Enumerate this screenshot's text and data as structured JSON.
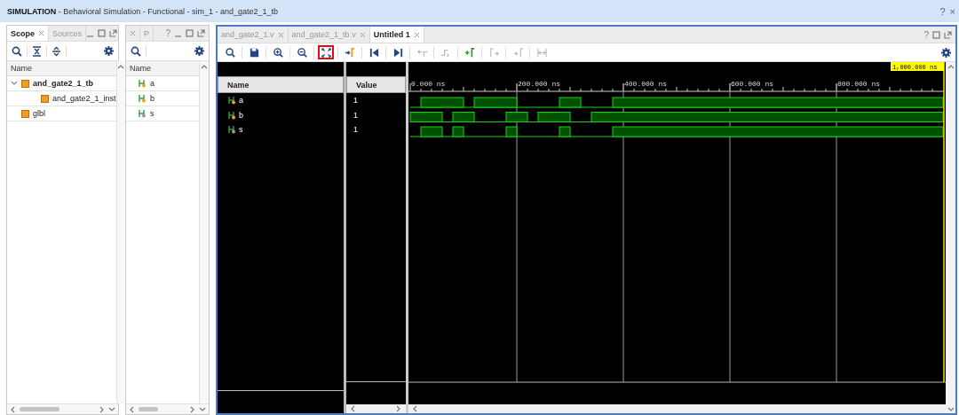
{
  "title_bar": {
    "title": "**SIMULATION** - Behavioral Simulation - Functional - sim_1 - and_gate2_1_tb",
    "help": "?",
    "close": "×"
  },
  "scope_panel": {
    "tabs": [
      {
        "label": "Scope",
        "selected": true
      },
      {
        "label": "Sources",
        "selected": false
      }
    ],
    "column": "Name",
    "tree": [
      {
        "name": "and_gate2_1_tb",
        "expanded": true,
        "children": [
          {
            "name": "and_gate2_1_inst"
          }
        ]
      },
      {
        "name": "glbl"
      }
    ]
  },
  "objects_panel": {
    "tabs": [
      {
        "label": "P",
        "selected": false
      }
    ],
    "help": "?",
    "column": "Name",
    "objects": [
      {
        "name": "a",
        "kind": "input"
      },
      {
        "name": "b",
        "kind": "input"
      },
      {
        "name": "s",
        "kind": "output"
      }
    ]
  },
  "wave_window": {
    "tabs": [
      {
        "label": "and_gate2_1.v",
        "selected": false
      },
      {
        "label": "and_gate2_1_tb.v",
        "selected": false
      },
      {
        "label": "Untitled 1",
        "selected": true
      }
    ],
    "help": "?",
    "toolbar": [
      {
        "kind": "search",
        "disabled": false,
        "highlighted": false
      },
      {
        "kind": "save",
        "disabled": false,
        "highlighted": false
      },
      {
        "kind": "zoom-in",
        "disabled": false,
        "highlighted": false
      },
      {
        "kind": "zoom-out",
        "disabled": false,
        "highlighted": false
      },
      {
        "kind": "zoom-fit",
        "disabled": false,
        "highlighted": true
      },
      {
        "kind": "go-to-cursor",
        "disabled": false,
        "highlighted": false
      },
      {
        "kind": "go-first",
        "disabled": false,
        "highlighted": false
      },
      {
        "kind": "go-last",
        "disabled": false,
        "highlighted": false
      },
      {
        "kind": "prev-transition",
        "disabled": true,
        "highlighted": false
      },
      {
        "kind": "next-transition",
        "disabled": true,
        "highlighted": false
      },
      {
        "kind": "add-marker",
        "disabled": false,
        "highlighted": false
      },
      {
        "kind": "prev-marker",
        "disabled": true,
        "highlighted": false
      },
      {
        "kind": "next-marker",
        "disabled": true,
        "highlighted": false
      },
      {
        "kind": "swap-cursors",
        "disabled": true,
        "highlighted": false
      }
    ],
    "cursor_time": "1,000.000 ns",
    "columns": [
      "Name",
      "Value"
    ],
    "ruler_labels": [
      "0.000 ns",
      "200.000 ns",
      "400.000 ns",
      "600.000 ns",
      "800.000 ns"
    ],
    "signals": [
      {
        "name": "a",
        "kind": "input",
        "value": "1"
      },
      {
        "name": "b",
        "kind": "input",
        "value": "1"
      },
      {
        "name": "s",
        "kind": "output",
        "value": "1"
      }
    ]
  }
}
